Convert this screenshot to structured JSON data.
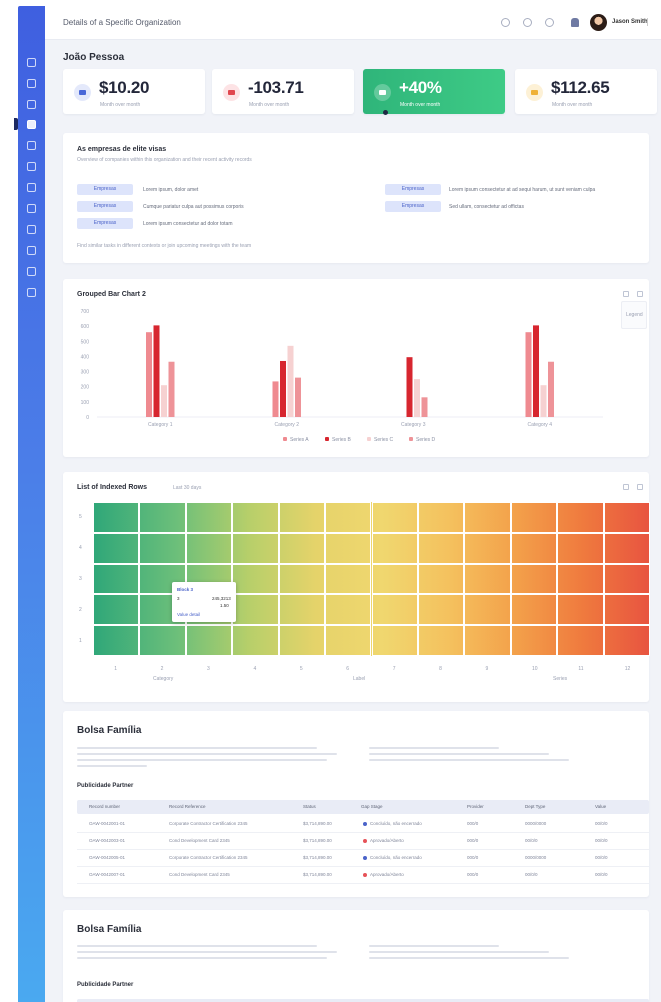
{
  "app": {
    "title": "Details of a Specific Organization",
    "user_name": "Jason Smith"
  },
  "page": {
    "title": "João Pessoa"
  },
  "kpis": [
    {
      "value": "$10.20",
      "label": "Month over month",
      "color": "#4a68d8",
      "bg": "#e4e9fb"
    },
    {
      "value": "-103.71",
      "label": "Month over month",
      "color": "#e0474f",
      "bg": "#fde3e5"
    },
    {
      "value": "+40%",
      "label": "Month over month",
      "color": "#ffffff",
      "bg": "#5ed59c"
    },
    {
      "value": "$112.65",
      "label": "Month over month",
      "color": "#efb136",
      "bg": "#fdf1d6"
    }
  ],
  "panel1": {
    "title": "As empresas de elite visas",
    "subtitle": "Overview of companies within this organization and their recent activity records",
    "chips": [
      {
        "label": "Empresas",
        "text": "Lorem ipsum, dolor amet"
      },
      {
        "label": "Empresas",
        "text": "Cumque pariatur culpa aut possimus corporis"
      },
      {
        "label": "Empresas",
        "text": "Lorem ipsum consectetur ad dolor totam"
      },
      {
        "label": "Empresas",
        "text": "Lorem ipsum consectetur at ad sequi harum, ut sunt veniam culpa"
      },
      {
        "label": "Empresas",
        "text": "Sed ullam, consectetur ad offictas"
      }
    ],
    "footer": "Find similar tasks in different contexts or join upcoming meetings with the team"
  },
  "bar_panel": {
    "title": "Grouped Bar Chart 2",
    "side_label": "Legend"
  },
  "chart_data": {
    "type": "bar",
    "title": "Grouped Bar Chart 2",
    "categories": [
      "Category 1",
      "Category 2",
      "Category 3",
      "Category 4"
    ],
    "yticks": [
      "0",
      "100",
      "200",
      "300",
      "400",
      "500",
      "600",
      "700"
    ],
    "ylim": [
      0,
      700
    ],
    "series": [
      {
        "name": "Series A",
        "color": "#ef8a90",
        "values": [
          560,
          235,
          0,
          560
        ]
      },
      {
        "name": "Series B",
        "color": "#d7262f",
        "values": [
          605,
          370,
          395,
          605
        ]
      },
      {
        "name": "Series C",
        "color": "#f6d1d1",
        "values": [
          210,
          470,
          250,
          210
        ]
      },
      {
        "name": "Series D",
        "color": "#ee9398",
        "values": [
          365,
          260,
          130,
          365
        ]
      }
    ],
    "legend_position": "bottom",
    "grid": false
  },
  "heat_panel": {
    "title": "List of Indexed Rows",
    "chip": "Last 30 days",
    "y_labels": [
      "5",
      "4",
      "3",
      "2",
      "1"
    ],
    "x_labels": [
      "1",
      "2",
      "3",
      "4",
      "5",
      "6",
      "7",
      "8",
      "9",
      "10",
      "11",
      "12"
    ],
    "x_group_labels": [
      "Category",
      "Label",
      "Series"
    ],
    "tooltip": {
      "title": "Block 3",
      "row1_label": "3",
      "row1_value": "245,3213",
      "row2_label": "",
      "row2_value": "1.50",
      "foot": "Value detail"
    }
  },
  "bolsa": {
    "title": "Bolsa Família",
    "subtitle": "Publicidade Partner",
    "columns": [
      "Record number",
      "Record Reference",
      "Status",
      "Gap Stage",
      "Provider",
      "Dept Type",
      "Value"
    ],
    "rows": [
      {
        "id": "OAW-0042001-01",
        "ref": "Corporate Contractor Certification 2345",
        "amount": "$3,714,890.00",
        "status": "Concluído, não encerrado",
        "dot": "#4b63c9",
        "c1": "000/0",
        "c2": "0000/0000",
        "c3": "00/0/0"
      },
      {
        "id": "OAW-0042003-01",
        "ref": "Cond Development Card 2345",
        "amount": "$3,714,890.00",
        "status": "Aprovado/Aberto",
        "dot": "#e65258",
        "c1": "000/0",
        "c2": "00/0/0",
        "c3": "00/0/0"
      },
      {
        "id": "OAW-0042005-01",
        "ref": "Corporate Contractor Certification 2345",
        "amount": "$3,714,890.00",
        "status": "Concluído, não encerrado",
        "dot": "#4b63c9",
        "c1": "000/0",
        "c2": "0000/0000",
        "c3": "00/0/0"
      },
      {
        "id": "OAW-0042007-01",
        "ref": "Cond Development Card 2345",
        "amount": "$3,714,890.00",
        "status": "Aprovado/Aberto",
        "dot": "#e65258",
        "c1": "000/0",
        "c2": "00/0/0",
        "c3": "00/0/0"
      }
    ]
  },
  "bolsa2": {
    "title": "Bolsa Família",
    "subtitle": "Publicidade Partner"
  }
}
